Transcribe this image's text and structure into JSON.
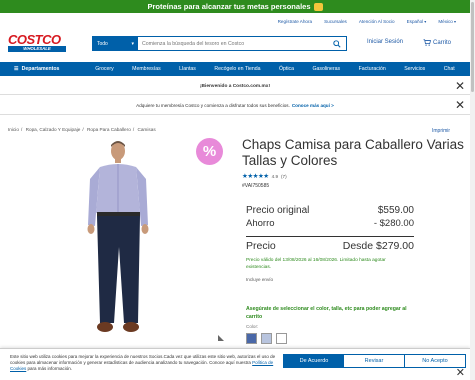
{
  "promo": {
    "text": "Proteínas para alcanzar tus metas personales"
  },
  "toplinks": {
    "register": "Regístrate Ahora",
    "branches": "Sucursales",
    "support": "Atención Al Socio",
    "language": "Español",
    "country": "México"
  },
  "logo": {
    "name": "COSTCO",
    "sub": "WHOLESALE"
  },
  "search": {
    "category": "Todo",
    "placeholder": "Comienza la búsqueda del tesoro en Costco"
  },
  "header": {
    "account": "Iniciar Sesión",
    "cart": "Carrito"
  },
  "nav": {
    "departments": "Departamentos",
    "items": [
      "Grocery",
      "Membresías",
      "Llantas",
      "Recógelo en Tienda",
      "Óptica",
      "Gasolineras",
      "Facturación",
      "Servicios",
      "Chat"
    ]
  },
  "banners": {
    "welcome": "¡Bienvenido a Costco.com.mx!",
    "membership": "Adquiere tu membresía Costco y comienza a disfrutar todos sus beneficios.",
    "membership_link": "Conoce más aquí >"
  },
  "breadcrumb": [
    "Inicio",
    "Ropa, Calzado Y Equipaje",
    "Ropa Para Caballero",
    "Camisas"
  ],
  "print_label": "Imprimir",
  "badge": "%",
  "product": {
    "title": "Chaps Camisa para Caballero Varias Tallas y Colores",
    "rating_value": "4.9",
    "rating_count": "(7)",
    "stars": 4.9,
    "item_number": "#VAI750585",
    "price_original_label": "Precio original",
    "price_original": "$559.00",
    "savings_label": "Ahorro",
    "savings": "- $280.00",
    "price_label": "Precio",
    "price_from": "Desde",
    "price": "$279.00",
    "validity": "Precio válido del 13/08/2026 al 16/08/2026. Limitado hasta agotar existencias.",
    "shipping": "Incluye envío",
    "select_note": "Asegúrate de seleccionar el color, talla, etc para poder agregar al carrito",
    "color_label": "Color:",
    "swatches": [
      "#4a68a8",
      "#b8c4de",
      "#ffffff"
    ]
  },
  "cookie": {
    "text": "Este sitio web utiliza cookies para mejorar la experiencia de nuestros Socios.Cada vez que utilizas este sitio web, autorizas el uso de cookies para almacenar información y generar estadísticas de audiencia analizando tu navegación. Conoce aquí nuestra",
    "link": "Política de Cookies",
    "text_end": "para más información.",
    "accept": "De Acuerdo",
    "review": "Revisar",
    "reject": "No Acepto"
  },
  "colors": {
    "brand_blue": "#0060a9",
    "brand_red": "#d71920",
    "promo_green": "#2e8b1e",
    "badge_pink": "#e88ad9"
  }
}
